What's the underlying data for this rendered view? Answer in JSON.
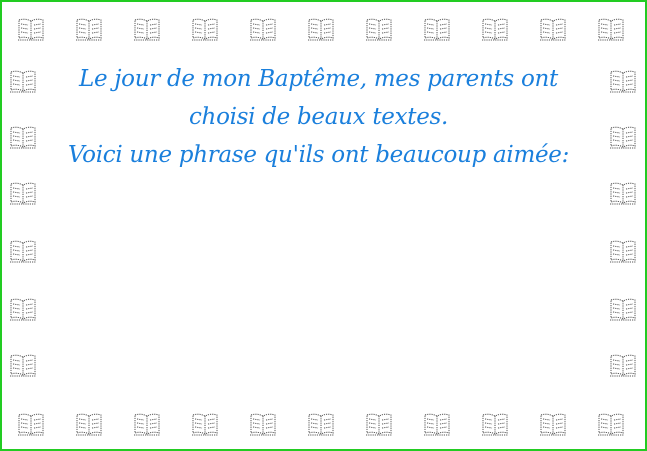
{
  "card": {
    "border_color": "#22cc22",
    "text_color": "#1a7fdc",
    "icon_name": "open-book-icon"
  },
  "text": {
    "line1": "Le jour de mon Baptême, mes parents ont",
    "line2": "choisi de beaux textes.",
    "line3": "Voici une phrase qu'ils ont beaucoup aimée:"
  }
}
